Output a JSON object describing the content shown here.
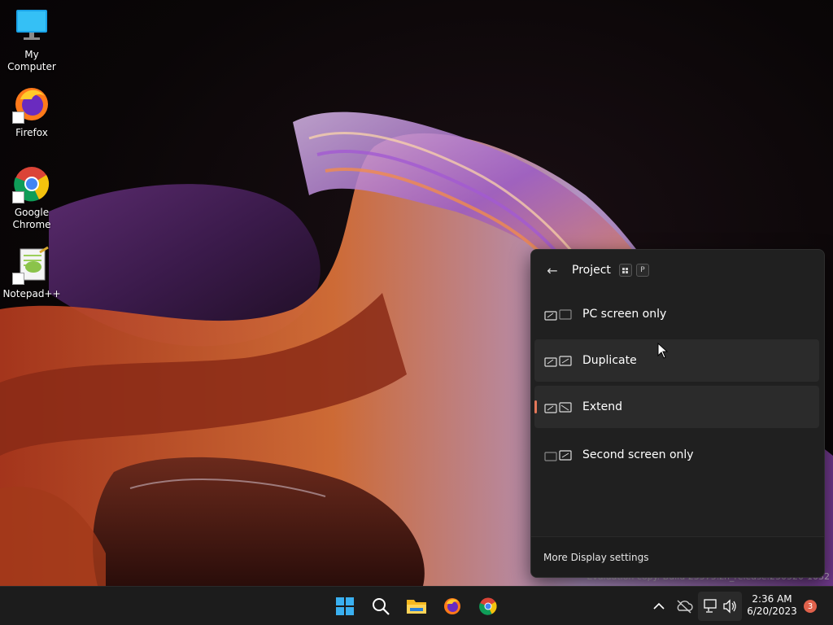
{
  "desktop": {
    "icons": [
      {
        "label": "My Computer"
      },
      {
        "label": "Firefox"
      },
      {
        "label": "Google Chrome"
      },
      {
        "label": "Notepad++"
      }
    ]
  },
  "project_panel": {
    "title": "Project",
    "shortcut_keys": [
      "P"
    ],
    "options": [
      {
        "label": "PC screen only",
        "state": "normal"
      },
      {
        "label": "Duplicate",
        "state": "hover"
      },
      {
        "label": "Extend",
        "state": "selected"
      },
      {
        "label": "Second screen only",
        "state": "normal"
      }
    ],
    "footer_link": "More Display settings"
  },
  "watermark": {
    "line1": "Evaluation copy. Build 23575.zn_release.230520-1032"
  },
  "taskbar": {
    "apps": [
      "start-icon",
      "search-icon",
      "file-explorer-icon",
      "firefox-icon",
      "chrome-icon"
    ],
    "clock": {
      "time": "2:36 AM",
      "date": "6/20/2023"
    },
    "notification_count": "3"
  },
  "colors": {
    "accent": "#e4785a",
    "panel_bg": "#202020",
    "taskbar_bg": "#1c1c1c",
    "badge": "#e0614b"
  }
}
